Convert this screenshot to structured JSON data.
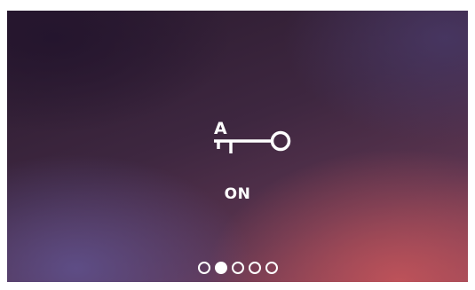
{
  "icon": {
    "name": "auto-key-icon",
    "letter": "A"
  },
  "status": {
    "label": "ON"
  },
  "pager": {
    "count": 5,
    "active_index": 1
  }
}
